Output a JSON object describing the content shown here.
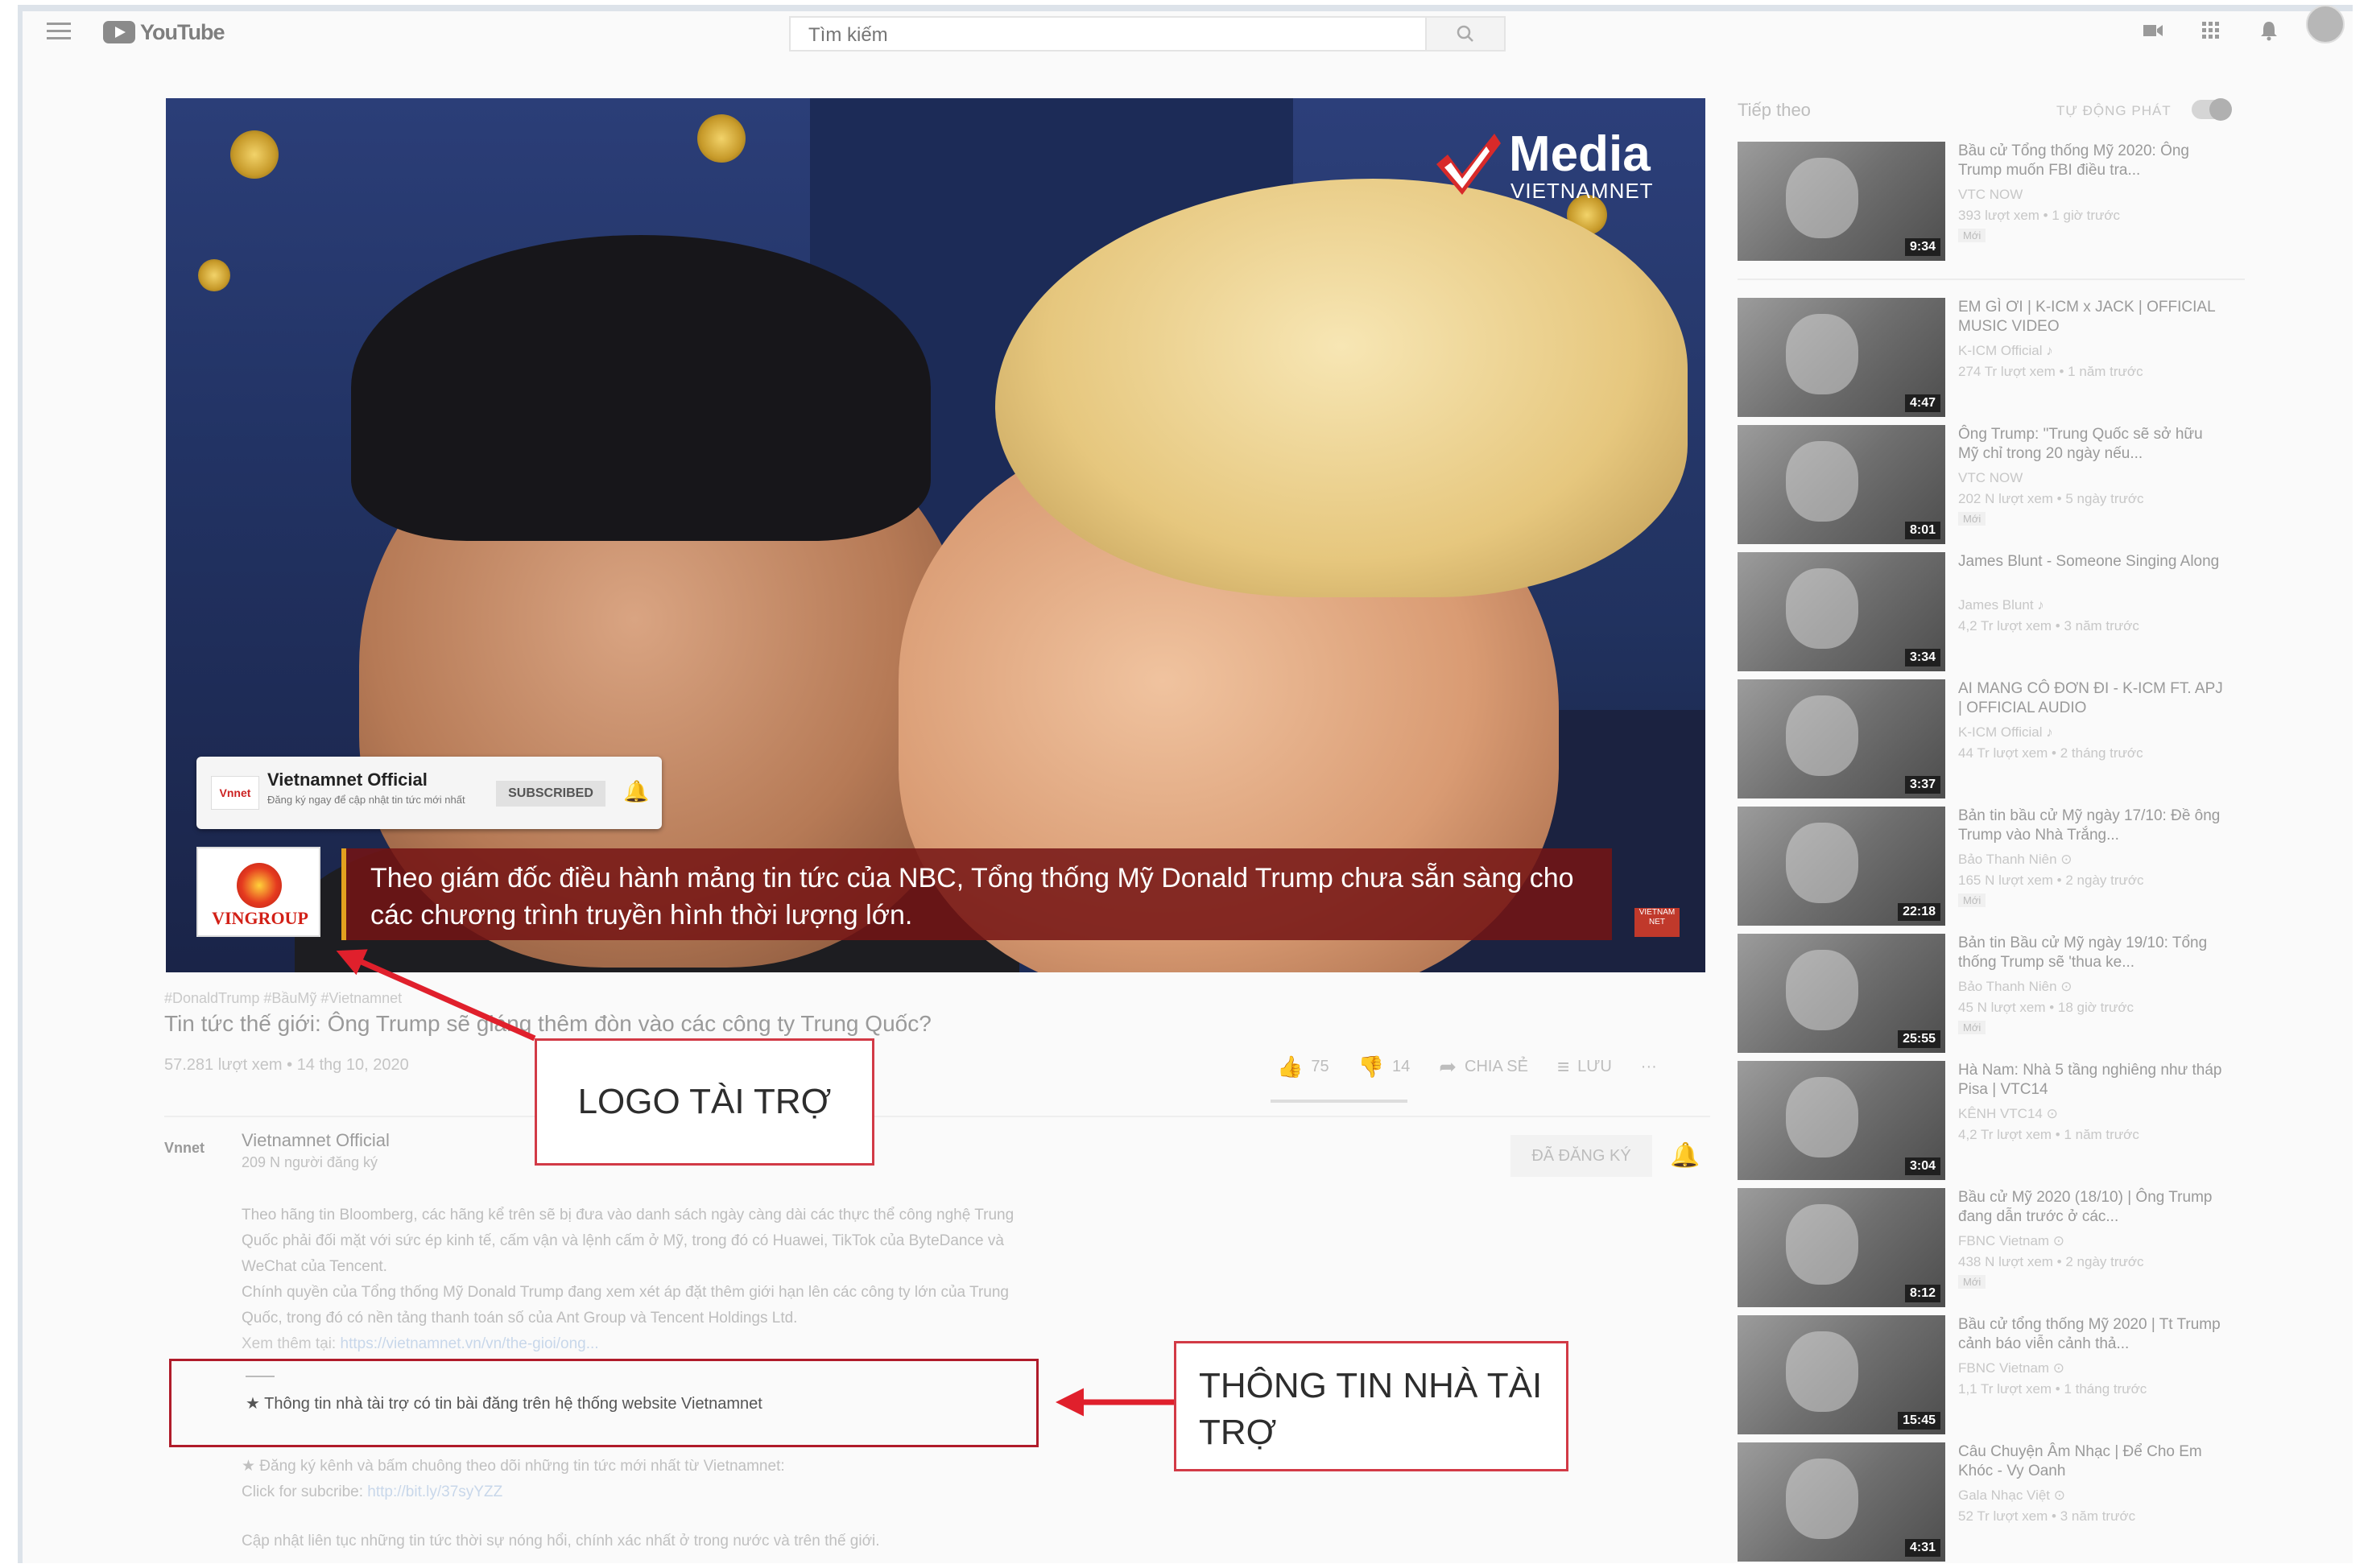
{
  "header": {
    "logo_text": "YouTube",
    "search_placeholder": "Tìm kiếm",
    "icons": [
      "menu-icon",
      "video-camera-icon",
      "apps-grid-icon",
      "bell-icon"
    ]
  },
  "player": {
    "brand": "Media",
    "brand_sub": "VIETNAMNET",
    "card": {
      "channel": "Vietnamnet Official",
      "logo_text": "Vnnet",
      "desc": "Đăng ký ngay để cập nhật tin tức mới nhất",
      "subscribe_label": "SUBSCRIBED"
    },
    "sponsor_logo_text": "VINGROUP",
    "caption": "Theo giám đốc điều hành mảng tin tức của NBC, Tổng thống Mỹ Donald Trump chưa sẵn sàng cho các chương trình truyền hình thời lượng lớn.",
    "mini_badge": "VIETNAM NET"
  },
  "video": {
    "hashtags": "#DonaldTrump #BầuMỹ #Vietnamnet",
    "title": "Tin tức thế giới: Ông Trump sẽ giáng thêm đòn vào các công ty Trung Quốc?",
    "meta": "57.281 lượt xem • 14 thg 10, 2020",
    "likes": "75",
    "dislikes": "14",
    "share_label": "CHIA SẺ",
    "save_label": "LƯU",
    "more_label": "···"
  },
  "channel": {
    "avatar_text": "Vnnet",
    "name": "Vietnamnet Official",
    "subs": "209 N người đăng ký",
    "subscribed_label": "ĐÃ ĐĂNG KÝ"
  },
  "description": {
    "p1": "Theo hãng tin Bloomberg, các hãng kể trên sẽ bị đưa vào danh sách ngày càng dài các thực thể công nghệ Trung Quốc phải đối mặt với sức ép kinh tế, cấm vận và lệnh cấm ở Mỹ, trong đó có Huawei, TikTok của ByteDance và WeChat của Tencent.",
    "p2": "Chính quyền của Tổng thống Mỹ Donald Trump đang xem xét áp đặt thêm giới hạn lên các công ty lớn của Trung Quốc, trong đó có nền tảng thanh toán số của Ant Group và Tencent Holdings Ltd.",
    "more_label": "Xem thêm tại:",
    "more_link": "https://vietnamnet.vn/vn/the-gioi/ong...",
    "sponsor_info": "★ Thông tin nhà tài trợ có tin bài đăng trên hệ thống website Vietnamnet",
    "subscribe_note": "★ Đăng ký kênh và bấm chuông theo dõi những tin tức mới nhất từ Vietnamnet:",
    "click_label": "Click for subcribe:",
    "click_link": "http://bit.ly/37syYZZ",
    "update_note": "Cập nhật liên tục những tin tức thời sự nóng hổi, chính xác nhất ở trong nước và trên thế giới."
  },
  "annotations": {
    "logo_callout": "LOGO TÀI TRỢ",
    "info_callout": "THÔNG TIN NHÀ TÀI TRỢ",
    "arrow_color": "#e0202c"
  },
  "sidebar": {
    "heading": "Tiếp theo",
    "autoplay_label": "TỰ ĐỘNG PHÁT",
    "items": [
      {
        "title": "Bầu cử Tổng thống Mỹ 2020: Ông Trump muốn FBI điều tra...",
        "channel": "VTC NOW",
        "meta": "393 lượt xem • 1 giờ trước",
        "badge": "Mới",
        "duration": "9:34"
      },
      {
        "title": "EM GÌ ƠI | K-ICM x JACK | OFFICIAL MUSIC VIDEO",
        "channel": "K-ICM Official ♪",
        "meta": "274 Tr lượt xem • 1 năm trước",
        "badge": "",
        "duration": "4:47"
      },
      {
        "title": "Ông Trump: \"Trung Quốc sẽ sở hữu Mỹ chỉ trong 20 ngày nếu...",
        "channel": "VTC NOW",
        "meta": "202 N lượt xem • 5 ngày trước",
        "badge": "Mới",
        "duration": "8:01"
      },
      {
        "title": "James Blunt - Someone Singing Along",
        "channel": "James Blunt ♪",
        "meta": "4,2 Tr lượt xem • 3 năm trước",
        "badge": "",
        "duration": "3:34"
      },
      {
        "title": "AI MANG CÔ ĐƠN ĐI - K-ICM FT. APJ | OFFICIAL AUDIO",
        "channel": "K-ICM Official ♪",
        "meta": "44 Tr lượt xem • 2 tháng trước",
        "badge": "",
        "duration": "3:37"
      },
      {
        "title": "Bản tin bầu cử Mỹ ngày 17/10: Đề ông Trump vào Nhà Trắng...",
        "channel": "Bảo Thanh Niên ⊙",
        "meta": "165 N lượt xem • 2 ngày trước",
        "badge": "Mới",
        "duration": "22:18"
      },
      {
        "title": "Bản tin Bầu cử Mỹ ngày 19/10: Tổng thống Trump sẽ 'thua ke...",
        "channel": "Bảo Thanh Niên ⊙",
        "meta": "45 N lượt xem • 18 giờ trước",
        "badge": "Mới",
        "duration": "25:55"
      },
      {
        "title": "Hà Nam: Nhà 5 tầng nghiêng như tháp Pisa | VTC14",
        "channel": "KÊNH VTC14 ⊙",
        "meta": "4,2 Tr lượt xem • 1 năm trước",
        "badge": "",
        "duration": "3:04"
      },
      {
        "title": "Bầu cử Mỹ 2020 (18/10) | Ông Trump đang dẫn trước ở các...",
        "channel": "FBNC Vietnam ⊙",
        "meta": "438 N lượt xem • 2 ngày trước",
        "badge": "Mới",
        "duration": "8:12"
      },
      {
        "title": "Bầu cử tổng thống Mỹ 2020 | Tt Trump cảnh báo viễn cảnh thả...",
        "channel": "FBNC Vietnam ⊙",
        "meta": "1,1 Tr lượt xem • 1 tháng trước",
        "badge": "",
        "duration": "15:45"
      },
      {
        "title": "Câu Chuyện Âm Nhạc | Để Cho Em Khóc - Vy Oanh",
        "channel": "Gala Nhạc Việt ⊙",
        "meta": "52 Tr lượt xem • 3 năm trước",
        "badge": "",
        "duration": "4:31"
      }
    ]
  }
}
